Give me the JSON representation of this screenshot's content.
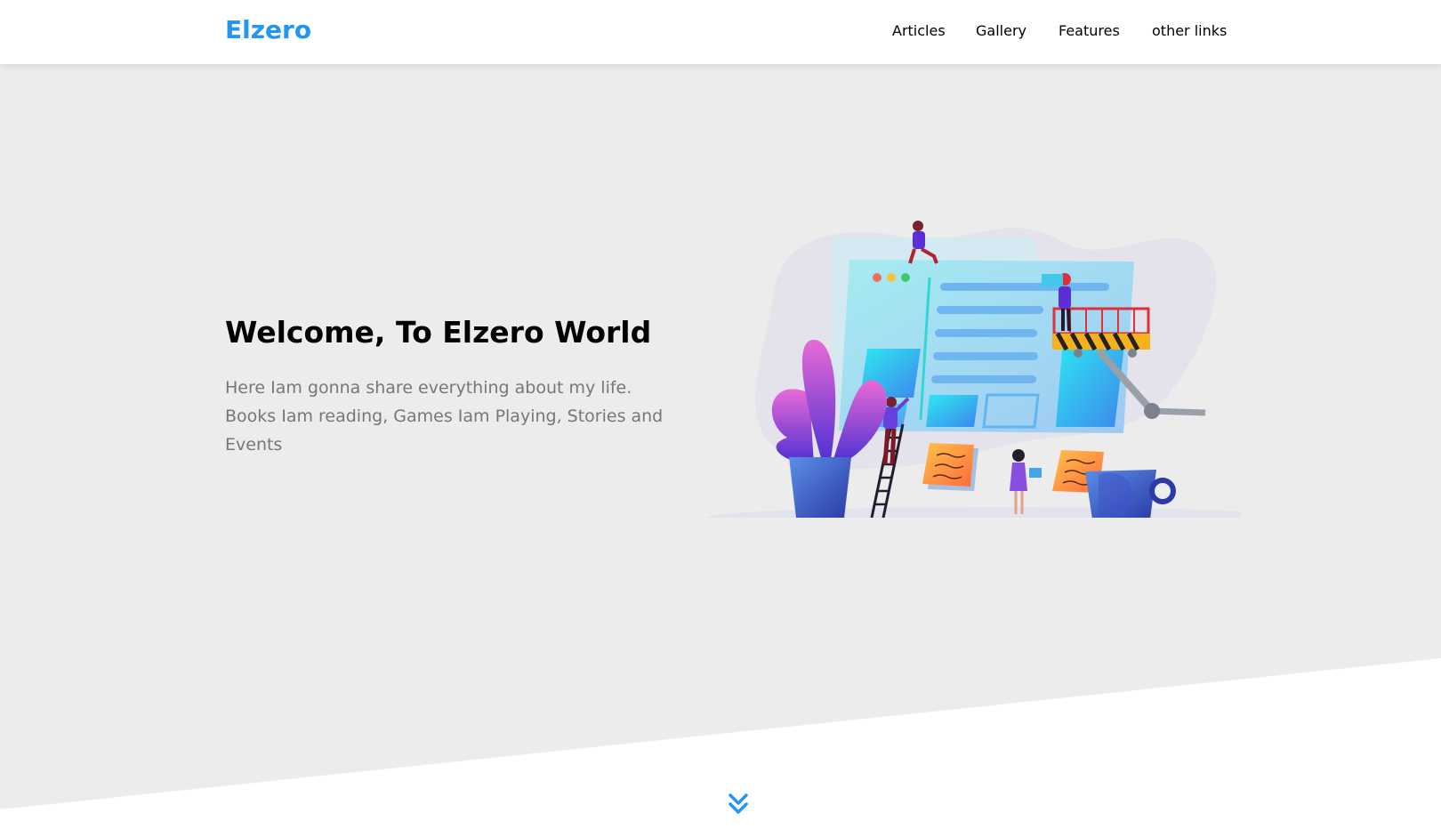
{
  "header": {
    "logo": "Elzero",
    "nav": [
      {
        "label": "Articles"
      },
      {
        "label": "Gallery"
      },
      {
        "label": "Features"
      },
      {
        "label": "other links"
      }
    ]
  },
  "landing": {
    "title": "Welcome, To Elzero World",
    "text": "Here Iam gonna share everything about my life. Books Iam reading, Games Iam Playing, Stories and Events",
    "illustration_icon": "landing-illustration",
    "scroll_icon": "double-chevron-down-icon"
  },
  "colors": {
    "accent": "#2196f3",
    "landing_bg": "#ececec",
    "text_muted": "#777777"
  }
}
